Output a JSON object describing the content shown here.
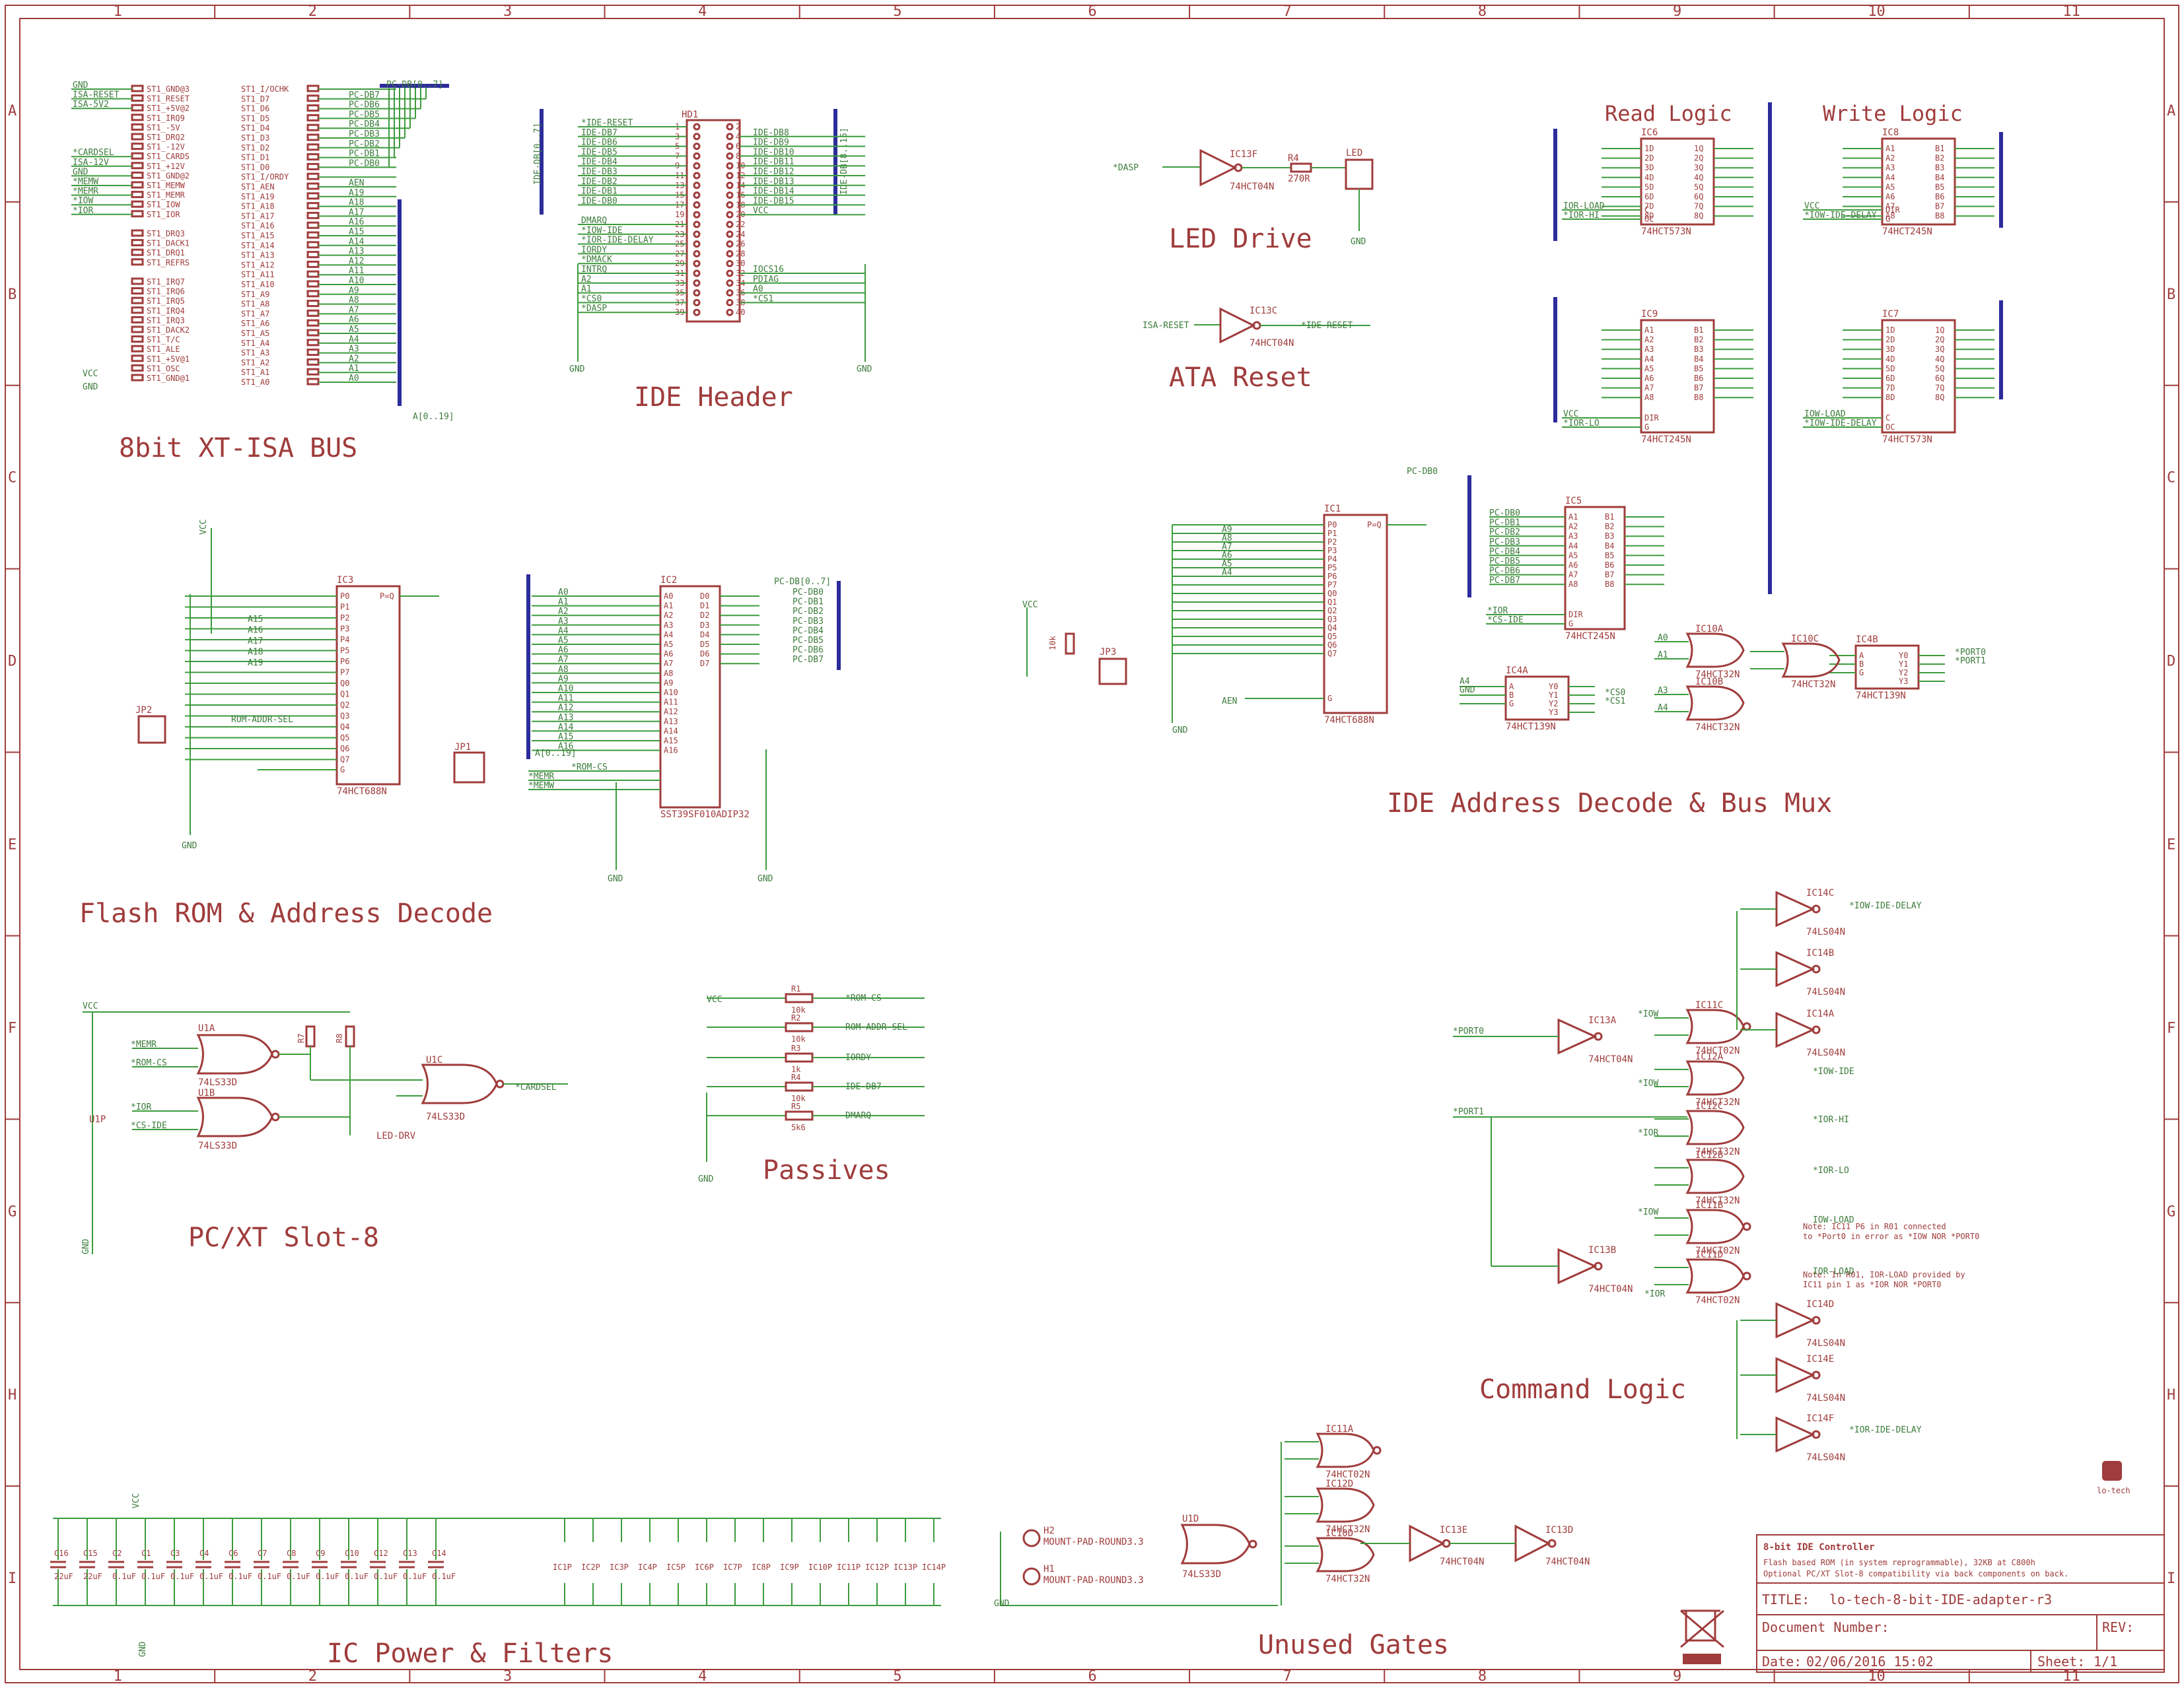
{
  "frame": {
    "columns": [
      "1",
      "2",
      "3",
      "4",
      "5",
      "6",
      "7",
      "8",
      "9",
      "10",
      "11"
    ],
    "rows": [
      "A",
      "B",
      "C",
      "D",
      "E",
      "F",
      "G",
      "H",
      "I"
    ]
  },
  "sections": {
    "isa_bus": "8bit XT-ISA BUS",
    "ide_header": "IDE Header",
    "led_drive": "LED Drive",
    "ata_reset": "ATA Reset",
    "read_logic": "Read Logic",
    "write_logic": "Write Logic",
    "flash_rom": "Flash ROM & Address Decode",
    "ide_decode": "IDE Address Decode & Bus Mux",
    "passives": "Passives",
    "pcxt_slot": "PC/XT Slot-8",
    "command_logic": "Command Logic",
    "power": "IC Power & Filters",
    "unused": "Unused Gates"
  },
  "isa": {
    "left_pins": [
      "ST1_GND@3",
      "ST1_RESET",
      "ST1_+5V@2",
      "ST1_IRQ9",
      "ST1_-5V",
      "ST1_DRQ2",
      "ST1_-12V",
      "ST1_CARDS",
      "ST1_+12V",
      "ST1_GND@2",
      "ST1_MEMW",
      "ST1_MEMR",
      "ST1_IOW",
      "ST1_IOR",
      "",
      "ST1_DRQ3",
      "ST1_DACK1",
      "ST1_DRQ1",
      "ST1_REFRS",
      "",
      "ST1_IRQ7",
      "ST1_IRQ6",
      "ST1_IRQ5",
      "ST1_IRQ4",
      "ST1_IRQ3",
      "ST1_DACK2",
      "ST1_T/C",
      "ST1_ALE",
      "ST1_+5V@1",
      "ST1_OSC",
      "ST1_GND@1"
    ],
    "left_nets": [
      "GND",
      "ISA-RESET",
      "ISA-5V2",
      "",
      "",
      "",
      "",
      "*CARDSEL",
      "ISA-12V",
      "GND",
      "*MEMW",
      "*MEMR",
      "*IOW",
      "*IOR"
    ],
    "right_pins": [
      "ST1_I/OCHK",
      "ST1_D7",
      "ST1_D6",
      "ST1_D5",
      "ST1_D4",
      "ST1_D3",
      "ST1_D2",
      "ST1_D1",
      "ST1_D0",
      "ST1_I/ORDY",
      "ST1_AEN",
      "ST1_A19",
      "ST1_A18",
      "ST1_A17",
      "ST1_A16",
      "ST1_A15",
      "ST1_A14",
      "ST1_A13",
      "ST1_A12",
      "ST1_A11",
      "ST1_A10",
      "ST1_A9",
      "ST1_A8",
      "ST1_A7",
      "ST1_A6",
      "ST1_A5",
      "ST1_A4",
      "ST1_A3",
      "ST1_A2",
      "ST1_A1",
      "ST1_A0"
    ],
    "data_nets": [
      "PC-DB7",
      "PC-DB6",
      "PC-DB5",
      "PC-DB4",
      "PC-DB3",
      "PC-DB2",
      "PC-DB1",
      "PC-DB0"
    ],
    "addr_nets": [
      "AEN",
      "A19",
      "A18",
      "A17",
      "A16",
      "A15",
      "A14",
      "A13",
      "A12",
      "A11",
      "A10",
      "A9",
      "A8",
      "A7",
      "A6",
      "A5",
      "A4",
      "A3",
      "A2",
      "A1",
      "A0"
    ],
    "bus_pc_db": "PC-DB[0..7]",
    "bus_a": "A[0..19]",
    "vcc": "VCC",
    "gnd": "GND"
  },
  "ide": {
    "ref": "HD1",
    "left_nets": [
      "*IDE-RESET",
      "IDE-DB7",
      "IDE-DB6",
      "IDE-DB5",
      "IDE-DB4",
      "IDE-DB3",
      "IDE-DB2",
      "IDE-DB1",
      "IDE-DB0",
      "",
      "DMARQ",
      "*IOW-IDE",
      "*IOR-IDE-DELAY",
      "IORDY",
      "*DMACK",
      "INTRQ",
      "A2",
      "A1",
      "*CS0",
      "*DASP"
    ],
    "right_nets": [
      "",
      "IDE-DB8",
      "IDE-DB9",
      "IDE-DB10",
      "IDE-DB11",
      "IDE-DB12",
      "IDE-DB13",
      "IDE-DB14",
      "IDE-DB15",
      "VCC",
      "",
      "",
      "",
      "",
      "",
      "IOCS16",
      "PDIAG",
      "A0",
      "*CS1",
      ""
    ],
    "bus_left": "IDE-DB[0..7]",
    "bus_right": "IDE-DB[8..15]",
    "gnd": "GND"
  },
  "led": {
    "ic": "IC13F",
    "ic_type": "74HCT04N",
    "net_in": "*DASP",
    "r_ref": "R4",
    "r_val": "270R",
    "led_ref": "LED",
    "gnd": "GND"
  },
  "reset": {
    "ic": "IC13C",
    "ic_type": "74HCT04N",
    "net_in": "ISA-RESET",
    "net_out": "*IDE-RESET"
  },
  "ic6": {
    "ref": "IC6",
    "type": "74HCT573N",
    "in": [
      "1D",
      "2D",
      "3D",
      "4D",
      "5D",
      "6D",
      "7D",
      "8D"
    ],
    "out": [
      "1Q",
      "2Q",
      "3Q",
      "4Q",
      "5Q",
      "6Q",
      "7Q",
      "8Q"
    ],
    "ctrl": [
      "C",
      "OC"
    ],
    "nets": [
      "IOR-LOAD",
      "*IOR-HI"
    ]
  },
  "ic8": {
    "ref": "IC8",
    "type": "74HCT245N",
    "in": [
      "A1",
      "A2",
      "A3",
      "A4",
      "A5",
      "A6",
      "A7",
      "A8"
    ],
    "out": [
      "B1",
      "B2",
      "B3",
      "B4",
      "B5",
      "B6",
      "B7",
      "B8"
    ],
    "ctrl": [
      "DIR",
      "G"
    ],
    "nets": [
      "VCC",
      "*IOW-IDE-DELAY"
    ]
  },
  "ic9": {
    "ref": "IC9",
    "type": "74HCT245N",
    "in": [
      "A1",
      "A2",
      "A3",
      "A4",
      "A5",
      "A6",
      "A7",
      "A8"
    ],
    "out": [
      "B1",
      "B2",
      "B3",
      "B4",
      "B5",
      "B6",
      "B7",
      "B8"
    ],
    "ctrl": [
      "DIR",
      "G"
    ],
    "nets": [
      "VCC",
      "*IOR-LO"
    ]
  },
  "ic7": {
    "ref": "IC7",
    "type": "74HCT573N",
    "in": [
      "1D",
      "2D",
      "3D",
      "4D",
      "5D",
      "6D",
      "7D",
      "8D"
    ],
    "out": [
      "1Q",
      "2Q",
      "3Q",
      "4Q",
      "5Q",
      "6Q",
      "7Q",
      "8Q"
    ],
    "ctrl": [
      "C",
      "OC"
    ],
    "nets": [
      "IOW-LOAD",
      "*IOW-IDE-DELAY"
    ]
  },
  "ic5": {
    "ref": "IC5",
    "type": "74HCT245N",
    "in": [
      "A1",
      "A2",
      "A3",
      "A4",
      "A5",
      "A6",
      "A7",
      "A8"
    ],
    "out": [
      "B1",
      "B2",
      "B3",
      "B4",
      "B5",
      "B6",
      "B7",
      "B8"
    ],
    "ctrl": [
      "DIR",
      "G"
    ],
    "nets": [
      "*IOR",
      "*CS-IDE"
    ],
    "bus_nets": [
      "PC-DB0",
      "PC-DB1",
      "PC-DB2",
      "PC-DB3",
      "PC-DB4",
      "PC-DB5",
      "PC-DB6",
      "PC-DB7"
    ]
  },
  "ic1": {
    "ref": "IC1",
    "type": "74HCT688N",
    "p": [
      "P0",
      "P1",
      "P2",
      "P3",
      "P4",
      "P5",
      "P6",
      "P7"
    ],
    "q": [
      "Q0",
      "Q1",
      "Q2",
      "Q3",
      "Q4",
      "Q5",
      "Q6",
      "Q7"
    ],
    "peq": "P=Q",
    "g": "G",
    "addr_nets": [
      "A9",
      "A8",
      "A7",
      "A6",
      "A5",
      "A4"
    ],
    "aen": "AEN",
    "vcc": "VCC",
    "jp": "JP3",
    "r": "R5",
    "r_val": "10k",
    "gnd": "GND"
  },
  "ic3": {
    "ref": "IC3",
    "type": "74HCT688N",
    "p": [
      "P0",
      "P1",
      "P2",
      "P3",
      "P4",
      "P5",
      "P6",
      "P7"
    ],
    "q": [
      "Q0",
      "Q1",
      "Q2",
      "Q3",
      "Q4",
      "Q5",
      "Q6",
      "Q7"
    ],
    "addr_nets": [
      "A15",
      "A16",
      "A17",
      "A18",
      "A19"
    ],
    "net_sel": "ROM-ADDR-SEL",
    "jp": "JP2",
    "vcc": "VCC",
    "gnd": "GND"
  },
  "ic2": {
    "ref": "IC2",
    "type": "SST39SF010ADIP32",
    "addr": [
      "A0",
      "A1",
      "A2",
      "A3",
      "A4",
      "A5",
      "A6",
      "A7",
      "A8",
      "A9",
      "A10",
      "A11",
      "A12",
      "A13",
      "A14",
      "A15",
      "A16"
    ],
    "data": [
      "D0",
      "D1",
      "D2",
      "D3",
      "D4",
      "D5",
      "D6",
      "D7"
    ],
    "data_nets": [
      "PC-DB0",
      "PC-DB1",
      "PC-DB2",
      "PC-DB3",
      "PC-DB4",
      "PC-DB5",
      "PC-DB6",
      "PC-DB7"
    ],
    "ctrl_nets": [
      "*ROM-CS",
      "*MEMR",
      "*MEMW"
    ],
    "jp": "JP1",
    "bus": "A[0..19]",
    "bus_db": "PC-DB[0..7]",
    "gnd": "GND"
  },
  "ic4a": {
    "ref": "IC4A",
    "type": "74HCT139N",
    "nets": [
      "A4",
      "GND"
    ],
    "outs": [
      "*CS0",
      "*CS1"
    ]
  },
  "ic4b": {
    "ref": "IC4B",
    "type": "74HCT139N",
    "outs": [
      "*PORT0",
      "*PORT1"
    ]
  },
  "ic10": {
    "a": "IC10A",
    "b": "IC10B",
    "c": "IC10C",
    "type": "74HCT32N",
    "nets": [
      "A0",
      "A1",
      "A3",
      "A4"
    ]
  },
  "passives": {
    "vcc": "VCC",
    "gnd": "GND",
    "items": [
      {
        "ref": "R1",
        "val": "10k",
        "net": "*ROM-CS"
      },
      {
        "ref": "R2",
        "val": "10k",
        "net": "ROM-ADDR-SEL"
      },
      {
        "ref": "R3",
        "val": "1k",
        "net": "IORDY"
      },
      {
        "ref": "R4",
        "val": "10k",
        "net": "IDE-DB7"
      },
      {
        "ref": "R5",
        "val": "5k6",
        "net": "DMARQ"
      }
    ]
  },
  "slot": {
    "vcc": "VCC",
    "u1a": "U1A",
    "u1b": "U1B",
    "u1c": "U1C",
    "u1p": "U1P",
    "type": "74LS33D",
    "r7": "R7",
    "r8": "R8",
    "r_val": "10k",
    "nets_in": [
      "*MEMR",
      "*ROM-CS",
      "*IOR",
      "*CS-IDE"
    ],
    "net_out": "*CARDSEL",
    "led_drv": "LED-DRV",
    "gnd": "GND"
  },
  "command": {
    "gates": [
      {
        "ref": "IC13A",
        "type": "74HCT04N"
      },
      {
        "ref": "IC11C",
        "type": "74HCT02N"
      },
      {
        "ref": "IC12A",
        "type": "74HCT32N"
      },
      {
        "ref": "IC12C",
        "type": "74HCT32N"
      },
      {
        "ref": "IC12B",
        "type": "74HCT32N"
      },
      {
        "ref": "IC11B",
        "type": "74HCT02N"
      },
      {
        "ref": "IC13B",
        "type": "74HCT04N"
      },
      {
        "ref": "IC11D",
        "type": "74HCT02N"
      },
      {
        "ref": "IC14C",
        "type": "74LS04N"
      },
      {
        "ref": "IC14B",
        "type": "74LS04N"
      },
      {
        "ref": "IC14A",
        "type": "74LS04N"
      },
      {
        "ref": "IC14D",
        "type": "74LS04N"
      },
      {
        "ref": "IC14E",
        "type": "74LS04N"
      },
      {
        "ref": "IC14F",
        "type": "74LS04N"
      }
    ],
    "nets": [
      "*PORT0",
      "*PORT1",
      "*IOW",
      "*IOR",
      "*IOW-IDE",
      "*IOR-HI",
      "*IOR-LO",
      "IOW-LOAD",
      "IOR-LOAD",
      "*IOW-IDE-DELAY",
      "*IOR-IDE-DELAY"
    ],
    "note1": "Note: IC11 P6 in R01 connected",
    "note2": "to *Port0 in error as *IOW NOR *PORT0",
    "note3": "Note: In R01, IOR-LOAD provided by",
    "note4": "IC11 pin 1 as *IOR NOR *PORT0"
  },
  "power": {
    "caps": [
      {
        "ref": "C16",
        "val": "22uF"
      },
      {
        "ref": "C15",
        "val": "22uF"
      },
      {
        "ref": "C2",
        "val": "0.1uF"
      },
      {
        "ref": "C1",
        "val": "0.1uF"
      },
      {
        "ref": "C3",
        "val": "0.1uF"
      },
      {
        "ref": "C4",
        "val": "0.1uF"
      },
      {
        "ref": "C6",
        "val": "0.1uF"
      },
      {
        "ref": "C7",
        "val": "0.1uF"
      },
      {
        "ref": "C8",
        "val": "0.1uF"
      },
      {
        "ref": "C9",
        "val": "0.1uF"
      },
      {
        "ref": "C10",
        "val": "0.1uF"
      },
      {
        "ref": "C12",
        "val": "0.1uF"
      },
      {
        "ref": "C13",
        "val": "0.1uF"
      },
      {
        "ref": "C14",
        "val": "0.1uF"
      }
    ],
    "ics": [
      "IC1P",
      "IC2P",
      "IC3P",
      "IC4P",
      "IC5P",
      "IC6P",
      "IC7P",
      "IC8P",
      "IC9P",
      "IC10P",
      "IC11P",
      "IC12P",
      "IC13P",
      "IC14P"
    ],
    "vcc": "VCC",
    "gnd": "GND"
  },
  "unused": {
    "gates": [
      {
        "ref": "IC11A",
        "type": "74HCT02N"
      },
      {
        "ref": "IC12D",
        "type": "74HCT32N"
      },
      {
        "ref": "IC10D",
        "type": "74HCT32N"
      },
      {
        "ref": "U1D",
        "type": "74LS33D"
      },
      {
        "ref": "IC13E",
        "type": "74HCT04N"
      },
      {
        "ref": "IC13D",
        "type": "74HCT04N"
      }
    ],
    "mounts": [
      {
        "ref": "H2",
        "label": "MOUNT-PAD-ROUND3.3"
      },
      {
        "ref": "H1",
        "label": "MOUNT-PAD-ROUND3.3"
      }
    ],
    "gnd": "GND"
  },
  "logo": "lo-tech",
  "title_block": {
    "heading": "8-bit IDE Controller",
    "desc1": "Flash based ROM (in system reprogrammable), 32KB at C800h",
    "desc2": "Optional PC/XT Slot-8 compatibility via back components on back.",
    "title_label": "TITLE:",
    "title_value": "lo-tech-8-bit-IDE-adapter-r3",
    "doc_label": "Document Number:",
    "rev_label": "REV:",
    "date_label": "Date:",
    "date_value": "02/06/2016 15:02",
    "sheet_label": "Sheet:",
    "sheet_value": "1/1"
  },
  "colors": {
    "frame": "#a03c3c",
    "wire": "#3c9c3c",
    "bus": "#2c2c9c",
    "text": "#a03c3c"
  }
}
